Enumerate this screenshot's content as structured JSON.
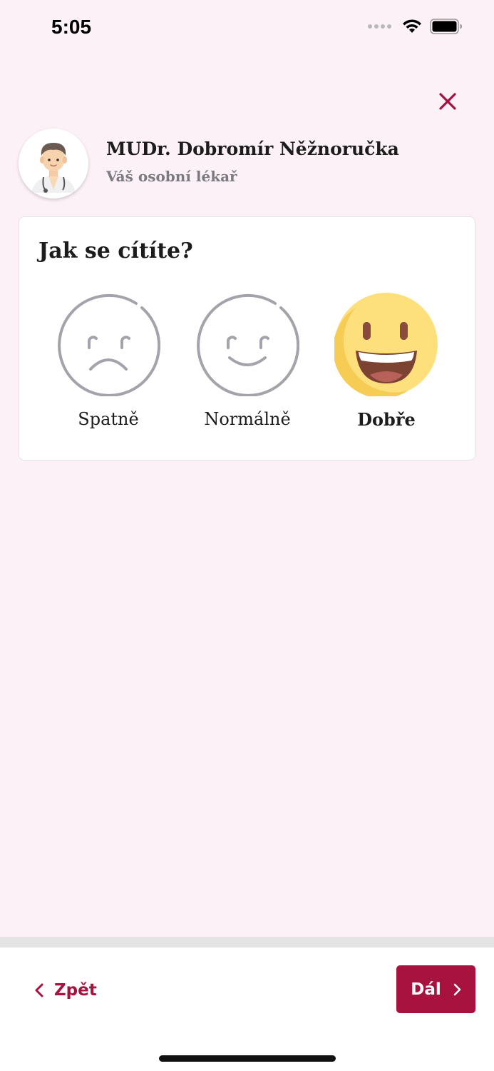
{
  "status_bar": {
    "time": "5:05",
    "icons": [
      "signal-icon",
      "wifi-icon",
      "battery-icon"
    ]
  },
  "header": {
    "close_icon": "close-icon",
    "doctor_name": "MUDr. Dobromír Něžnoručka",
    "doctor_role": "Váš osobní lékař",
    "avatar_icon": "doctor-avatar"
  },
  "card": {
    "title": "Jak se cítíte?",
    "options": [
      {
        "label": "Spatně",
        "icon": "sad-face-icon",
        "selected": false
      },
      {
        "label": "Normálně",
        "icon": "neutral-smile-icon",
        "selected": false
      },
      {
        "label": "Dobře",
        "icon": "happy-face-icon",
        "selected": true
      }
    ]
  },
  "footer": {
    "back_label": "Zpět",
    "next_label": "Dál"
  },
  "colors": {
    "background": "#fcf1f6",
    "accent": "#a8123f",
    "muted_text": "#7a7a80",
    "emoji_yellow": "#fde07c"
  }
}
